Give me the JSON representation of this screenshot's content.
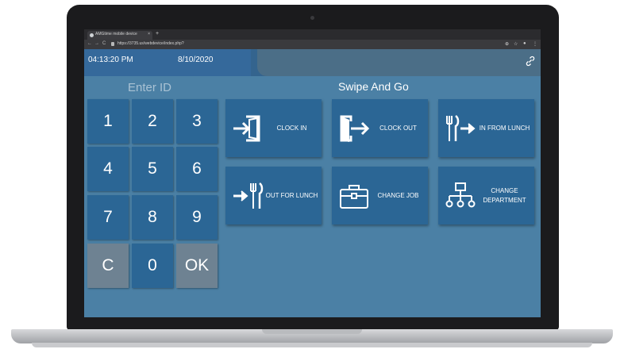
{
  "browser": {
    "tab_title": "AMGtime mobile device",
    "tab_close": "×",
    "new_tab": "+",
    "url": "https://3735.us/webdevice/index.php?",
    "nav_back": "←",
    "nav_forward": "→",
    "nav_reload": "C"
  },
  "header": {
    "time": "04:13:20 PM",
    "date": "8/10/2020"
  },
  "keypad": {
    "title": "Enter ID",
    "keys": [
      "1",
      "2",
      "3",
      "4",
      "5",
      "6",
      "7",
      "8",
      "9",
      "C",
      "0",
      "OK"
    ]
  },
  "swipe": {
    "title": "Swipe And Go",
    "tiles": [
      {
        "label": "CLOCK IN",
        "icon": "clock-in-icon"
      },
      {
        "label": "CLOCK OUT",
        "icon": "clock-out-icon"
      },
      {
        "label": "IN FROM LUNCH",
        "icon": "in-from-lunch-icon"
      },
      {
        "label": "OUT FOR LUNCH",
        "icon": "out-for-lunch-icon"
      },
      {
        "label": "CHANGE JOB",
        "icon": "briefcase-icon"
      },
      {
        "label": "CHANGE DEPARTMENT",
        "icon": "org-chart-icon"
      }
    ]
  },
  "colors": {
    "background": "#4b80a5",
    "tile": "#2b6695",
    "grey_key": "#6e8292"
  }
}
